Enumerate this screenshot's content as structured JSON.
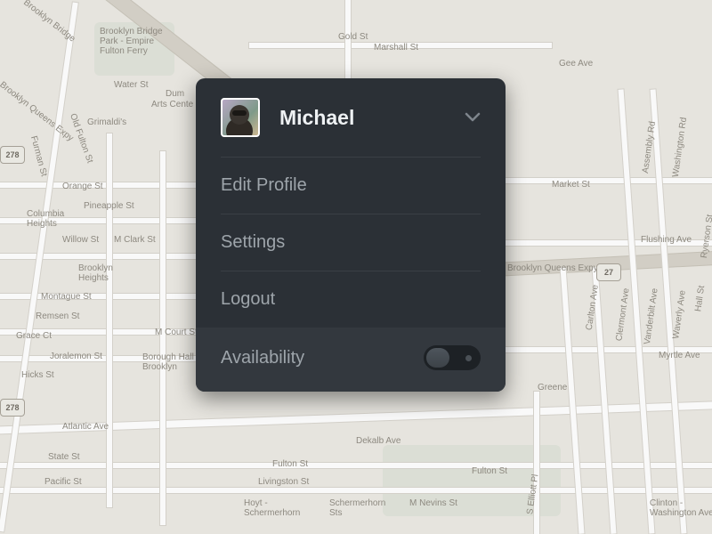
{
  "user": {
    "name": "Michael"
  },
  "menu": {
    "edit_profile": "Edit Profile",
    "settings": "Settings",
    "logout": "Logout",
    "availability_label": "Availability",
    "availability_on": false
  },
  "map": {
    "labels": {
      "brooklyn_bridge_park": "Brooklyn Bridge\nPark - Empire\nFulton Ferry",
      "water_st": "Water St",
      "dumbo": "Dum",
      "arts_center": "Arts Cente",
      "grimaldis": "Grimaldi's",
      "bqe_left": "Brooklyn Queens Expy",
      "brooklyn_bridge": "Brooklyn Bridge",
      "old_fulton": "Old Fulton St",
      "furman": "Furman St",
      "orange": "Orange St",
      "pineapple": "Pineapple St",
      "columbia_heights": "Columbia\nHeights",
      "willow": "Willow St",
      "clark": "M Clark St",
      "brooklyn_heights": "Brooklyn\nHeights",
      "montague": "Montague St",
      "remsen": "Remsen St",
      "court": "M Court St",
      "grace": "Grace Ct",
      "joralemon": "Joralemon St",
      "hicks": "Hicks St",
      "borough_hall": "Borough Hall -\nBrooklyn",
      "atlantic": "Atlantic Ave",
      "state": "State St",
      "pacific": "Pacific St",
      "gold": "Gold St",
      "marshall": "Marshall St",
      "fulton": "Fulton St",
      "livingston": "Livingston St",
      "schermerhorn": "Schermerhorn\nSts",
      "hoyt": "Hoyt - \nSchermerhorn",
      "dekalb": "Dekalb Ave",
      "nevins": "M Nevins St",
      "gee": "Gee Ave",
      "market": "Market St",
      "flushing": "Flushing Ave",
      "bqe_right": "Brooklyn Queens Expy",
      "assembly": "Assembly Rd",
      "washington": "Washington Rd",
      "ryerson": "Ryerson St",
      "hall_r": "Hall St",
      "carlton": "Carlton Ave",
      "clermont": "Clermont Ave",
      "vanderbilt": "Vanderbilt Ave",
      "waverly": "Waverly Ave",
      "myrtle": "Myrtle Ave",
      "greene": "Greene",
      "fulton_r": "Fulton St",
      "s_elliott": "S Elliott Pl",
      "clinton_wash": "Clinton - \nWashington Ave",
      "shield_278a": "278",
      "shield_278b": "278",
      "shield_27": "27"
    }
  }
}
